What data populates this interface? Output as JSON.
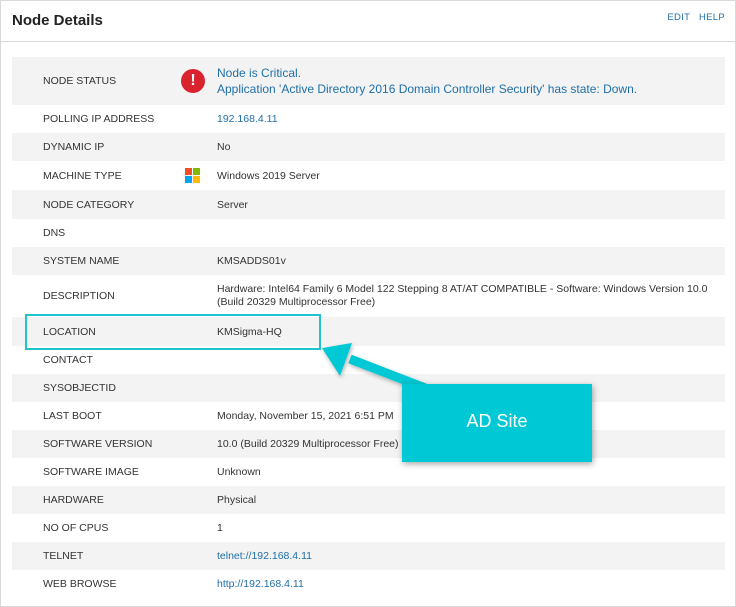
{
  "header": {
    "title": "Node Details",
    "edit_label": "EDIT",
    "help_label": "HELP"
  },
  "status": {
    "label": "NODE STATUS",
    "icon": "critical-alert-icon",
    "line1": "Node is Critical.",
    "line2": "Application 'Active Directory 2016 Domain Controller Security' has state: Down."
  },
  "rows": [
    {
      "label": "POLLING IP ADDRESS",
      "value": "192.168.4.11"
    },
    {
      "label": "DYNAMIC IP",
      "value": "No"
    },
    {
      "label": "MACHINE TYPE",
      "value": "Windows 2019 Server",
      "icon": "windows-logo-icon"
    },
    {
      "label": "NODE CATEGORY",
      "value": "Server"
    },
    {
      "label": "DNS",
      "value": ""
    },
    {
      "label": "SYSTEM NAME",
      "value": "KMSADDS01v"
    },
    {
      "label": "DESCRIPTION",
      "value": "Hardware: Intel64 Family 6 Model 122 Stepping 8 AT/AT COMPATIBLE - Software: Windows Version 10.0 (Build 20329 Multiprocessor Free)"
    },
    {
      "label": "LOCATION",
      "value": "KMSigma-HQ"
    },
    {
      "label": "CONTACT",
      "value": ""
    },
    {
      "label": "SYSOBJECTID",
      "value": ""
    },
    {
      "label": "LAST BOOT",
      "value": "Monday, November 15, 2021 6:51 PM"
    },
    {
      "label": "SOFTWARE VERSION",
      "value": "10.0 (Build 20329 Multiprocessor Free)"
    },
    {
      "label": "SOFTWARE IMAGE",
      "value": "Unknown"
    },
    {
      "label": "HARDWARE",
      "value": "Physical"
    },
    {
      "label": "NO OF CPUS",
      "value": "1"
    },
    {
      "label": "TELNET",
      "value": "telnet://192.168.4.11"
    },
    {
      "label": "WEB BROWSE",
      "value": "http://192.168.4.11"
    }
  ],
  "callout": {
    "text": "AD Site"
  },
  "colors": {
    "accent": "#00c8d4",
    "link": "#1f6fa8",
    "critical": "#d9232e"
  }
}
